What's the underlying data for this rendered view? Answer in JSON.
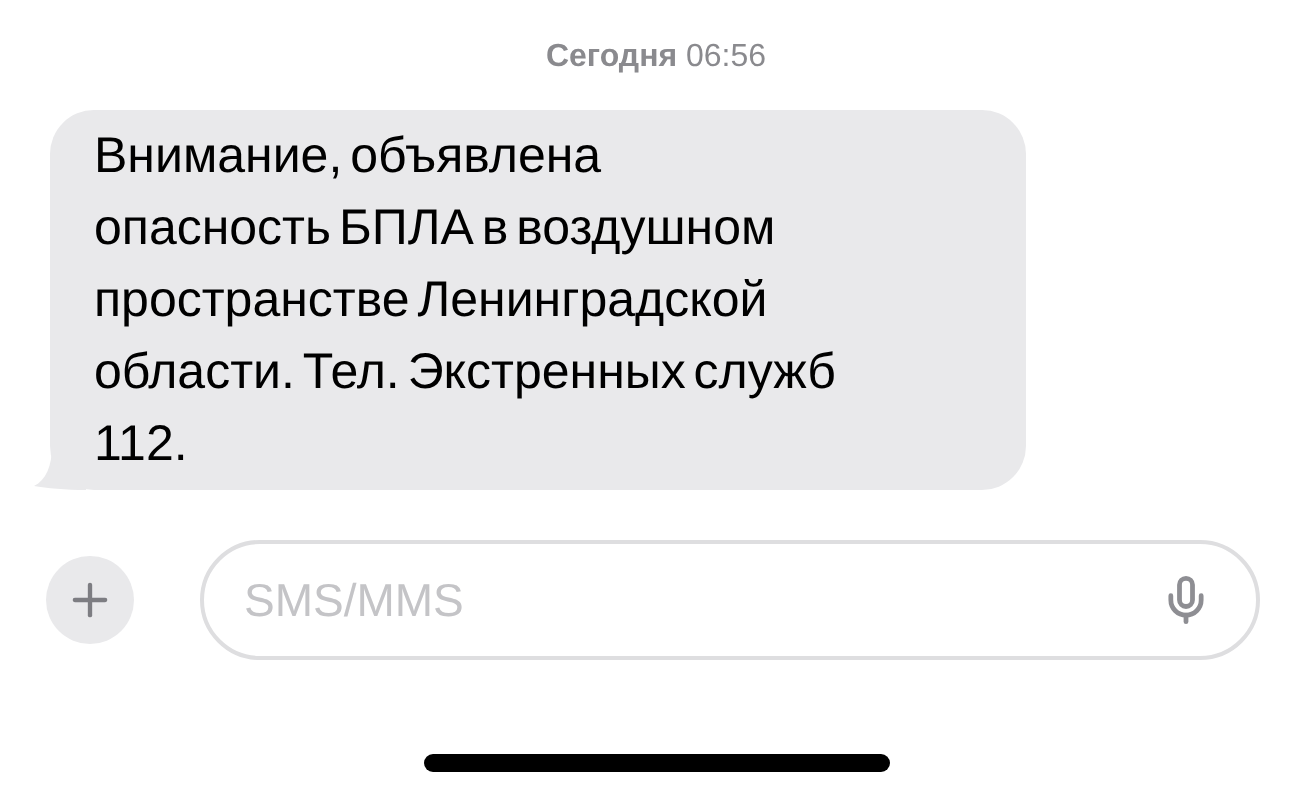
{
  "timestamp": "**Сегодня** 06:56",
  "messages": [
    {
      "text": "Внимание, объявлена опасность БПЛА в воздушном пространстве Ленинградской области. Тел. Экстренных служб 112."
    }
  ],
  "composer": {
    "placeholder": "SMS/MMS"
  }
}
